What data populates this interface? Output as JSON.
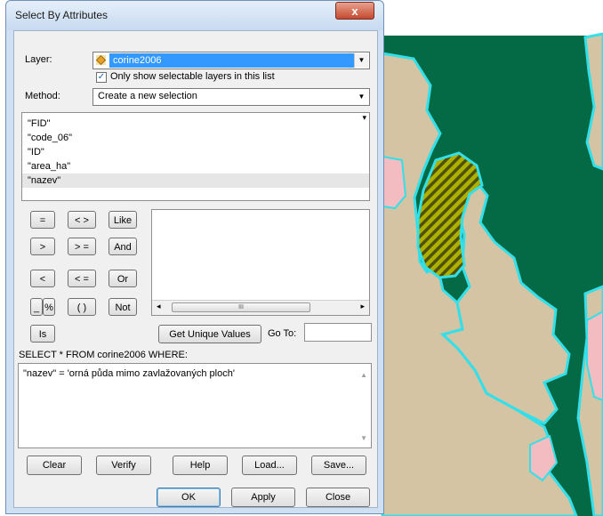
{
  "dialog": {
    "title": "Select By Attributes",
    "close_glyph": "x",
    "layer_label": "Layer:",
    "layer_value": "corine2006",
    "layer_icon": "layer-diamond-icon",
    "only_selectable_label": "Only show selectable layers in this list",
    "only_selectable_checked": true,
    "method_label": "Method:",
    "method_value": "Create a new selection",
    "fields": [
      "\"FID\"",
      "\"code_06\"",
      "\"ID\"",
      "\"area_ha\"",
      "\"nazev\""
    ],
    "selected_field": "\"nazev\"",
    "operators": {
      "eq": "=",
      "ne": "< >",
      "like": "Like",
      "gt": ">",
      "ge": "> =",
      "and": "And",
      "lt": "<",
      "le": "< =",
      "or": "Or",
      "us": "_",
      "pct": "%",
      "paren": "( )",
      "not": "Not",
      "is": "Is"
    },
    "get_unique_label": "Get Unique Values",
    "goto_label": "Go To:",
    "goto_value": "",
    "query_prefix": "SELECT * FROM corine2006 WHERE:",
    "query_text": "\"nazev\" = 'orná půda mimo zavlažovaných ploch'",
    "buttons": {
      "clear": "Clear",
      "verify": "Verify",
      "help": "Help",
      "load": "Load...",
      "save": "Save...",
      "ok": "OK",
      "apply": "Apply",
      "close": "Close"
    },
    "hscroll_thumb_glyph": "III"
  },
  "colors": {
    "map_dark_green": "#036a45",
    "map_tan": "#d4c4a4",
    "map_cyan_outline": "#33dfe8",
    "map_pink": "#f2bcc0",
    "map_hatch": "#6e7000",
    "dialog_frame": "#cfe0f3",
    "selection_blue": "#3399ff"
  }
}
